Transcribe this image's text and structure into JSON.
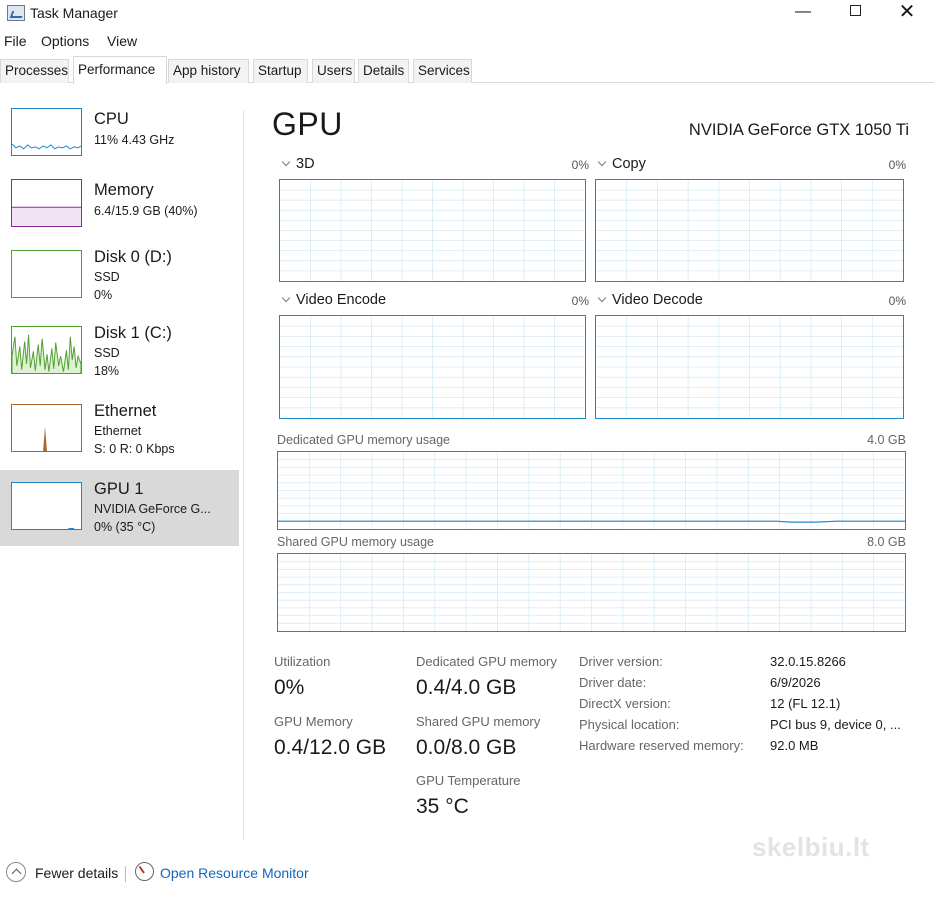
{
  "window": {
    "title": "Task Manager",
    "minimize_glyph": "—",
    "close_glyph": "✕"
  },
  "menu": [
    "File",
    "Options",
    "View"
  ],
  "tabs": [
    "Processes",
    "Performance",
    "App history",
    "Startup",
    "Users",
    "Details",
    "Services"
  ],
  "active_tab": "Performance",
  "sidebar": {
    "selected": "GPU 1",
    "items": [
      {
        "name": "CPU",
        "line1": "11% 4.43 GHz",
        "line2": "",
        "color": "#1b88c9"
      },
      {
        "name": "Memory",
        "line1": "6.4/15.9 GB (40%)",
        "line2": "",
        "color": "#8b2a9a"
      },
      {
        "name": "Disk 0 (D:)",
        "line1": "SSD",
        "line2": "0%",
        "color": "#4da02e"
      },
      {
        "name": "Disk 1 (C:)",
        "line1": "SSD",
        "line2": "18%",
        "color": "#4da02e"
      },
      {
        "name": "Ethernet",
        "line1": "Ethernet",
        "line2": "S: 0 R: 0 Kbps",
        "color": "#a8652a"
      },
      {
        "name": "GPU 1",
        "line1": "NVIDIA GeForce G...",
        "line2": "0% (35 °C)",
        "color": "#1b88c9"
      }
    ]
  },
  "main": {
    "title": "GPU",
    "model": "NVIDIA GeForce GTX 1050 Ti",
    "engines": [
      {
        "label": "3D",
        "value": "0%"
      },
      {
        "label": "Copy",
        "value": "0%"
      },
      {
        "label": "Video Encode",
        "value": "0%"
      },
      {
        "label": "Video Decode",
        "value": "0%"
      }
    ],
    "dedicated_memory": {
      "label": "Dedicated GPU memory usage",
      "max": "4.0 GB"
    },
    "shared_memory": {
      "label": "Shared GPU memory usage",
      "max": "8.0 GB"
    },
    "stats": {
      "utilization": {
        "label": "Utilization",
        "value": "0%"
      },
      "gpu_memory": {
        "label": "GPU Memory",
        "value": "0.4/12.0 GB"
      },
      "dedicated": {
        "label": "Dedicated GPU memory",
        "value": "0.4/4.0 GB"
      },
      "shared": {
        "label": "Shared GPU memory",
        "value": "0.0/8.0 GB"
      },
      "temperature": {
        "label": "GPU Temperature",
        "value": "35 °C"
      }
    },
    "info": [
      {
        "label": "Driver version:",
        "value": "32.0.15.8266"
      },
      {
        "label": "Driver date:",
        "value": "6/9/2026"
      },
      {
        "label": "DirectX version:",
        "value": "12 (FL 12.1)"
      },
      {
        "label": "Physical location:",
        "value": "PCI bus 9, device 0, ..."
      },
      {
        "label": "Hardware reserved memory:",
        "value": "92.0 MB"
      }
    ]
  },
  "footer": {
    "fewer_details": "Fewer details",
    "open_resource_monitor": "Open Resource Monitor"
  },
  "watermark": "skelbiu.lt",
  "colors": {
    "graph_border": "#1b88c9",
    "grid": "#d7ebf6",
    "selected_bg": "#d9d9d9",
    "link": "#1565c0"
  }
}
